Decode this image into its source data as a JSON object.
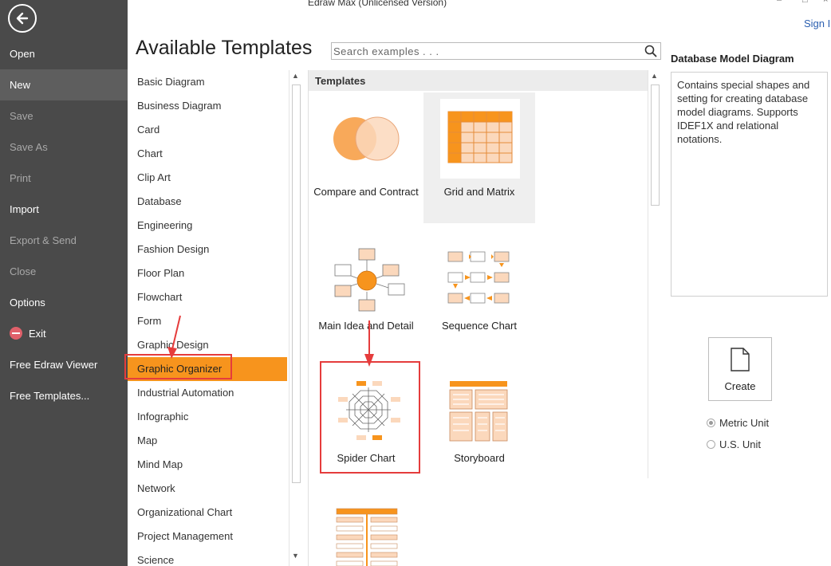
{
  "window": {
    "title": "Edraw Max (Unlicensed Version)",
    "sign_in": "Sign I"
  },
  "sidebar": {
    "items": [
      {
        "label": "Open",
        "state": "normal"
      },
      {
        "label": "New",
        "state": "active"
      },
      {
        "label": "Save",
        "state": "disabled"
      },
      {
        "label": "Save As",
        "state": "disabled"
      },
      {
        "label": "Print",
        "state": "disabled"
      },
      {
        "label": "Import",
        "state": "normal"
      },
      {
        "label": "Export & Send",
        "state": "disabled"
      },
      {
        "label": "Close",
        "state": "disabled"
      },
      {
        "label": "Options",
        "state": "normal"
      },
      {
        "label": "Exit",
        "state": "normal",
        "icon": "exit-icon"
      },
      {
        "label": "Free Edraw Viewer",
        "state": "normal"
      },
      {
        "label": "Free Templates...",
        "state": "normal"
      }
    ]
  },
  "main": {
    "title": "Available Templates",
    "search": {
      "placeholder": "Search examples . . .",
      "value": ""
    }
  },
  "categories": {
    "selected": "Graphic Organizer",
    "items": [
      "Basic Diagram",
      "Business Diagram",
      "Card",
      "Chart",
      "Clip Art",
      "Database",
      "Engineering",
      "Fashion Design",
      "Floor Plan",
      "Flowchart",
      "Form",
      "Graphic Design",
      "Graphic Organizer",
      "Industrial Automation",
      "Infographic",
      "Map",
      "Mind Map",
      "Network",
      "Organizational Chart",
      "Project Management",
      "Science"
    ]
  },
  "templates": {
    "header": "Templates",
    "items": [
      {
        "label": "Compare and Contract",
        "icon": "venn-diagram-icon"
      },
      {
        "label": "Grid and Matrix",
        "icon": "grid-matrix-icon"
      },
      {
        "label": "Main Idea and Detail",
        "icon": "main-idea-icon"
      },
      {
        "label": "Sequence Chart",
        "icon": "sequence-chart-icon"
      },
      {
        "label": "Spider Chart",
        "icon": "spider-chart-icon"
      },
      {
        "label": "Storyboard",
        "icon": "storyboard-icon"
      },
      {
        "label": "",
        "icon": "fishbone-icon"
      }
    ]
  },
  "details": {
    "title": "Database Model Diagram",
    "description": "Contains special shapes and setting for creating database model diagrams. Supports IDEF1X and relational notations.",
    "create_label": "Create",
    "units": {
      "metric": "Metric Unit",
      "us": "U.S. Unit",
      "selected": "Metric Unit"
    }
  },
  "colors": {
    "accent": "#f7941d",
    "sidebar_bg": "#4a4a4a",
    "annotation": "#e53c3c"
  }
}
